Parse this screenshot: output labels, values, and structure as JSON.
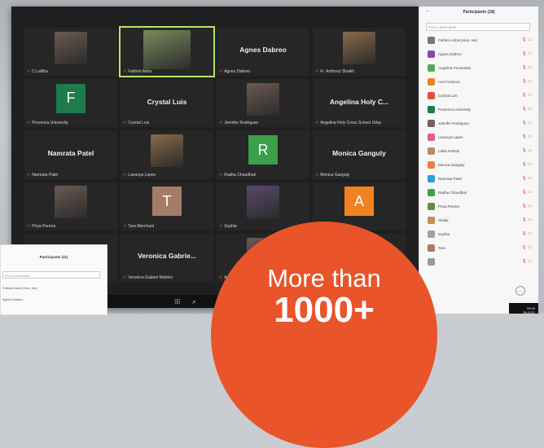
{
  "meeting": {
    "tiles": [
      {
        "type": "photo",
        "name": "C.Lalitha"
      },
      {
        "type": "photo",
        "name": "Fathimi Asha",
        "active": true
      },
      {
        "type": "text",
        "big": "Agnes Dabreo",
        "name": "Agnes Dabreo"
      },
      {
        "type": "photo",
        "name": "Fr. Anthony Shaikh"
      },
      {
        "type": "letter",
        "letter": "F",
        "color": "#1f7a4c",
        "name": "Provenza University"
      },
      {
        "type": "text",
        "big": "Crystal Luis",
        "name": "Crystal Luis"
      },
      {
        "type": "photo",
        "name": "Jennifer Rodrigues"
      },
      {
        "type": "text",
        "big": "Angelina Holy C...",
        "name": "Angelina Holy Cross School Uday"
      },
      {
        "type": "text",
        "big": "Namrata Patel",
        "name": "Namrata Patel"
      },
      {
        "type": "photo",
        "name": "Lavanya Lopes"
      },
      {
        "type": "letter",
        "letter": "R",
        "color": "#3aa04a",
        "name": "Radha Chaudhari"
      },
      {
        "type": "text",
        "big": "Monica Ganguly",
        "name": "Monica Ganguly"
      },
      {
        "type": "photo",
        "name": "Priya Pereira"
      },
      {
        "type": "letter",
        "letter": "T",
        "color": "#a57c68",
        "name": "Tara Merchant"
      },
      {
        "type": "photo",
        "name": "Sophia"
      },
      {
        "type": "letter",
        "letter": "A",
        "color": "#f08222",
        "name": "Ann Fonseca"
      },
      {
        "type": "empty",
        "name": ""
      },
      {
        "type": "text",
        "big": "Veronica Gabrie...",
        "name": "Veronica Gabriel Martins"
      },
      {
        "type": "photo",
        "name": "Angelina Holy Cross"
      },
      {
        "type": "empty",
        "name": ""
      }
    ]
  },
  "participants_panel": {
    "title": "Participants (18)",
    "dash": "–",
    "search_placeholder": "Find a participant",
    "items": [
      {
        "name": "Fathimi Asha (Host, me)",
        "color": "#777"
      },
      {
        "name": "Agnes Dabreo",
        "color": "#8e44ad"
      },
      {
        "name": "Angelina Fernandes",
        "color": "#4caf50"
      },
      {
        "name": "Ann Fonseca",
        "color": "#f08222"
      },
      {
        "name": "Crystal Luis",
        "color": "#e74c3c"
      },
      {
        "name": "Provenza University",
        "color": "#1f7a4c"
      },
      {
        "name": "Jennifer Rodrigues",
        "color": "#7b5e57"
      },
      {
        "name": "Lavanya Lopes",
        "color": "#e55b8c"
      },
      {
        "name": "Lalita Pathak",
        "color": "#b38b6d"
      },
      {
        "name": "Monica Ganguly",
        "color": "#ef7f39"
      },
      {
        "name": "Namrata Patel",
        "color": "#2d9cdb"
      },
      {
        "name": "Radha Chaudhari",
        "color": "#3aa04a"
      },
      {
        "name": "Priya Pereira",
        "color": "#6a8a3a"
      },
      {
        "name": "Shaila",
        "color": "#c98c55"
      },
      {
        "name": "Sophia",
        "color": "#a0a0a0"
      },
      {
        "name": "Tara",
        "color": "#a57c68"
      },
      {
        "name": "",
        "color": "#999"
      }
    ],
    "mic_icons": "🎙 ▭",
    "time": "09:15",
    "date": "08-2021"
  },
  "inset_panel": {
    "title": "Participants (11)",
    "search_placeholder": "Find a participant",
    "rows": [
      "Fathimi Asha (Host, me)",
      "Agnes Dabreo"
    ]
  },
  "promo": {
    "line1": "More than",
    "line2": "1000+"
  }
}
